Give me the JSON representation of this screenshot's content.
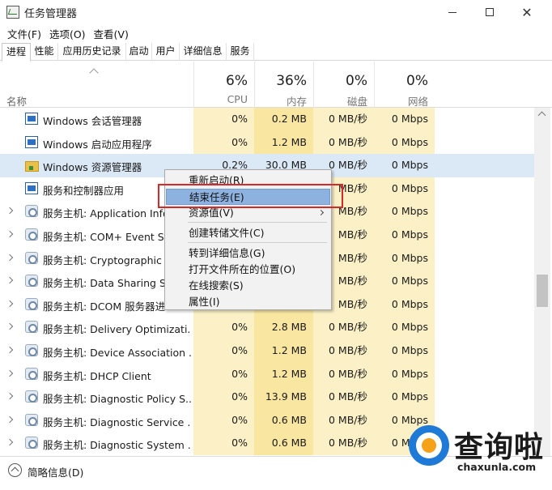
{
  "window": {
    "title": "任务管理器",
    "controls": [
      "minimize",
      "maximize",
      "close"
    ]
  },
  "menu": [
    "文件(F)",
    "选项(O)",
    "查看(V)"
  ],
  "tabs": [
    "进程",
    "性能",
    "应用历史记录",
    "启动",
    "用户",
    "详细信息",
    "服务"
  ],
  "active_tab": "进程",
  "columns": {
    "name_label": "名称",
    "cpu": {
      "pct": "6%",
      "label": "CPU"
    },
    "memory": {
      "pct": "36%",
      "label": "内存"
    },
    "disk": {
      "pct": "0%",
      "label": "磁盘"
    },
    "network": {
      "pct": "0%",
      "label": "网络"
    }
  },
  "rows": [
    {
      "name": "Windows 会话管理器",
      "cpu": "0%",
      "mem": "0.2 MB",
      "disk": "0 MB/秒",
      "net": "0 Mbps",
      "icon": "window-icon",
      "expandable": false
    },
    {
      "name": "Windows 启动应用程序",
      "cpu": "0%",
      "mem": "1.2 MB",
      "disk": "0 MB/秒",
      "net": "0 Mbps",
      "icon": "window-icon",
      "expandable": false
    },
    {
      "name": "Windows 资源管理器",
      "cpu": "0.2%",
      "mem": "30.0 MB",
      "disk": "0 MB/秒",
      "net": "0 Mbps",
      "icon": "folder-icon",
      "expandable": false,
      "selected": true
    },
    {
      "name": "服务和控制器应用",
      "cpu": "",
      "mem": "",
      "disk": "MB/秒",
      "net": "0 Mbps",
      "icon": "window-icon",
      "expandable": false
    },
    {
      "name": "服务主机: Application Info",
      "cpu": "",
      "mem": "",
      "disk": "MB/秒",
      "net": "0 Mbps",
      "icon": "gear-icon",
      "expandable": true
    },
    {
      "name": "服务主机: COM+ Event Sys",
      "cpu": "",
      "mem": "",
      "disk": "MB/秒",
      "net": "0 Mbps",
      "icon": "gear-icon",
      "expandable": true
    },
    {
      "name": "服务主机: Cryptographic S",
      "cpu": "",
      "mem": "",
      "disk": "MB/秒",
      "net": "0 Mbps",
      "icon": "gear-icon",
      "expandable": true
    },
    {
      "name": "服务主机: Data Sharing Se",
      "cpu": "",
      "mem": "",
      "disk": "MB/秒",
      "net": "0 Mbps",
      "icon": "gear-icon",
      "expandable": true
    },
    {
      "name": "服务主机: DCOM 服务器进",
      "cpu": "",
      "mem": "",
      "disk": "MB/秒",
      "net": "0 Mbps",
      "icon": "gear-icon",
      "expandable": true
    },
    {
      "name": "服务主机: Delivery Optimizati...",
      "cpu": "0%",
      "mem": "2.8 MB",
      "disk": "0 MB/秒",
      "net": "0 Mbps",
      "icon": "gear-icon",
      "expandable": true
    },
    {
      "name": "服务主机: Device Association ...",
      "cpu": "0%",
      "mem": "1.2 MB",
      "disk": "0 MB/秒",
      "net": "0 Mbps",
      "icon": "gear-icon",
      "expandable": true
    },
    {
      "name": "服务主机: DHCP Client",
      "cpu": "0%",
      "mem": "1.2 MB",
      "disk": "0 MB/秒",
      "net": "0 Mbps",
      "icon": "gear-icon",
      "expandable": true
    },
    {
      "name": "服务主机: Diagnostic Policy S...",
      "cpu": "0%",
      "mem": "13.9 MB",
      "disk": "0 MB/秒",
      "net": "0 Mbps",
      "icon": "gear-icon",
      "expandable": true
    },
    {
      "name": "服务主机: Diagnostic Service ...",
      "cpu": "0%",
      "mem": "0.6 MB",
      "disk": "0 MB/秒",
      "net": "0 Mbps",
      "icon": "gear-icon",
      "expandable": true
    },
    {
      "name": "服务主机: Diagnostic System ...",
      "cpu": "0%",
      "mem": "0.6 MB",
      "disk": "0 MB/秒",
      "net": "0 Mbps",
      "icon": "gear-icon",
      "expandable": true
    }
  ],
  "context_menu": {
    "items": [
      {
        "label": "重新启动(R)",
        "highlight": false,
        "submenu": false
      },
      {
        "label": "结束任务(E)",
        "highlight": true,
        "submenu": false
      },
      {
        "label": "资源值(V)",
        "highlight": false,
        "submenu": true
      },
      {
        "label": "创建转储文件(C)",
        "highlight": false,
        "submenu": false
      },
      {
        "label": "转到详细信息(G)",
        "highlight": false,
        "submenu": false
      },
      {
        "label": "打开文件所在的位置(O)",
        "highlight": false,
        "submenu": false
      },
      {
        "label": "在线搜索(S)",
        "highlight": false,
        "submenu": false
      },
      {
        "label": "属性(I)",
        "highlight": false,
        "submenu": false
      }
    ]
  },
  "footer": {
    "label": "简略信息(D)"
  },
  "watermark": {
    "text_cn": "查询啦",
    "text_en": "chaxunla.com"
  },
  "colors": {
    "cpu_bg": "#fbf0c6",
    "mem_bg": "#f9e6a0",
    "selected_row": "#dbe8f6",
    "menu_highlight": "#8db2e0",
    "callout": "#d62a2a"
  }
}
